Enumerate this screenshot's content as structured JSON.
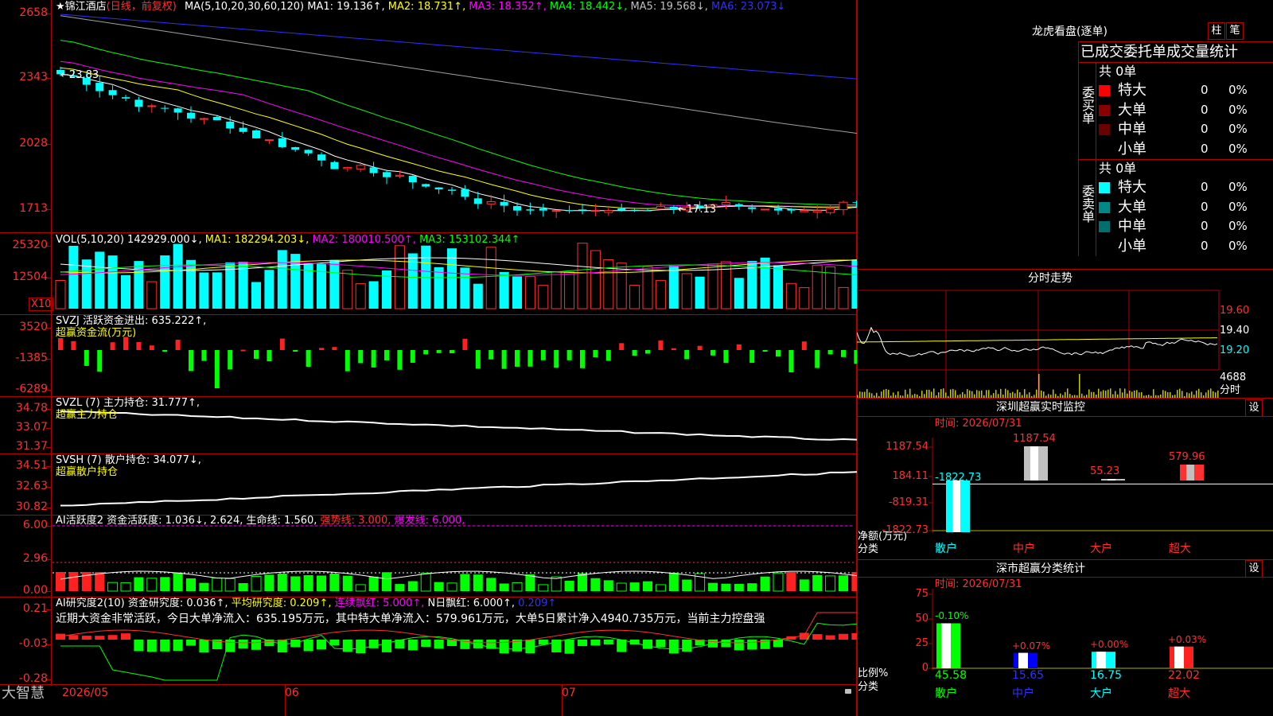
{
  "header": {
    "stock_name": "★锦江酒店",
    "period": "(日线，前复权)",
    "ma_label": "MA(5,10,20,30,60,120)",
    "ma": [
      {
        "label": "MA1: 19.136↑",
        "color": "#ffffff"
      },
      {
        "label": "MA2: 18.731↑",
        "color": "#ffff00"
      },
      {
        "label": "MA3: 18.352↑",
        "color": "#ff00ff"
      },
      {
        "label": "MA4: 18.442↓",
        "color": "#00ff00"
      },
      {
        "label": "MA5: 19.568↓",
        "color": "#c0c0c0"
      },
      {
        "label": "MA6: 23.073↓",
        "color": "#3030ff"
      }
    ]
  },
  "price_panel": {
    "y_ticks": [
      "2658",
      "2343",
      "2028",
      "1713"
    ],
    "high_marker": "←23.83",
    "low_marker": "←17.13"
  },
  "vol_panel": {
    "title": "VOL(5,10,20)",
    "value": "142929.000↓,",
    "ma1": "MA1: 182294.203↓,",
    "ma2": "MA2: 180010.500↑,",
    "ma3": "MA3: 153102.344↑",
    "y_ticks": [
      "25320",
      "12504"
    ],
    "unit": "X10"
  },
  "svzj_panel": {
    "title": "SVZJ  活跃资金进出: 635.222↑,",
    "subtitle": "超赢资金流(万元)",
    "y_ticks": [
      "3520",
      "-1385",
      "-6289"
    ]
  },
  "svzl_panel": {
    "title": "SVZL (7) 主力持仓: 31.777↑,",
    "subtitle": "超赢主力持仓",
    "y_ticks": [
      "34.78",
      "33.07",
      "31.37"
    ]
  },
  "svsh_panel": {
    "title": "SVSH (7) 散户持仓: 34.077↓,",
    "subtitle": "超赢散户持仓",
    "y_ticks": [
      "34.51",
      "32.63",
      "30.82"
    ]
  },
  "ai_active_panel": {
    "title": "AI活跃度2 资金活跃度: 1.036↓,",
    "v2": "2.624,",
    "life": "生命线: 1.560,",
    "strong": "强势线: 3.000,",
    "burst": "爆发线: 6.000,",
    "y_ticks": [
      "6.00",
      "2.96",
      "0.00"
    ]
  },
  "ai_research_panel": {
    "title": "AI研究度2(10) 资金研究度: 0.036↑,",
    "avg": "平均研究度: 0.209↑,",
    "cont": "连续飘红: 5.000↑,",
    "nday": "N日飘红: 6.000↑,",
    "last": "0.209↑",
    "comment": "近期大资金非常活跃，今日大单净流入：635.195万元，其中特大单净流入：579.961万元，大单5日累计净入4940.735万元，当前主力控盘强",
    "y_ticks": [
      "0.21",
      "-0.03",
      "-0.28"
    ]
  },
  "bottom_bar": {
    "brand": "大智慧",
    "dates": [
      "2026/05",
      "06",
      "07"
    ]
  },
  "lhb": {
    "title": "龙虎看盘(逐单)",
    "btn_zhu": "柱",
    "btn_bi": "笔",
    "tab_deal": "已成交",
    "tab_order": "委托单成交量统计",
    "buy_label": "委买单",
    "sell_label": "委卖单",
    "buy_total": "共 0单",
    "sell_total": "共 0单",
    "buy_rows": [
      {
        "label": "特大",
        "count": "0",
        "pct": "0%",
        "color": "#ff0000"
      },
      {
        "label": "大单",
        "count": "0",
        "pct": "0%",
        "color": "#8a0000"
      },
      {
        "label": "中单",
        "count": "0",
        "pct": "0%",
        "color": "#6a0000"
      },
      {
        "label": "小单",
        "count": "0",
        "pct": "0%",
        "color": "#000000"
      }
    ],
    "sell_rows": [
      {
        "label": "特大",
        "count": "0",
        "pct": "0%",
        "color": "#00ffff"
      },
      {
        "label": "大单",
        "count": "0",
        "pct": "0%",
        "color": "#008888"
      },
      {
        "label": "中单",
        "count": "0",
        "pct": "0%",
        "color": "#006f6f"
      },
      {
        "label": "小单",
        "count": "0",
        "pct": "0%",
        "color": "#000000"
      }
    ]
  },
  "fenshi": {
    "title": "分时走势",
    "y_ticks": [
      "19.60",
      "19.40",
      "19.20"
    ],
    "vol_tick": "4688",
    "vol_label": "分时"
  },
  "sz_monitor": {
    "title": "深圳超赢实时监控",
    "btn": "设",
    "time": "时间: 2026/07/31",
    "y_ticks": [
      "1187.54",
      "184.11",
      "-819.31",
      "-1822.73"
    ],
    "ylabel1": "净额(万元)",
    "ylabel2": "分类",
    "categories": [
      "散户",
      "中户",
      "大户",
      "超大"
    ],
    "values": [
      -1822.73,
      1187.54,
      55.23,
      579.96
    ],
    "value_labels": [
      "-1822.73",
      "1187.54",
      "55.23",
      "579.96"
    ]
  },
  "sz_stats": {
    "title": "深市超赢分类统计",
    "btn": "设",
    "time": "时间: 2026/07/31",
    "y_ticks": [
      "75",
      "50",
      "25",
      "0"
    ],
    "ylabel1": "比例%",
    "ylabel2": "分类",
    "categories": [
      "散户",
      "中户",
      "大户",
      "超大"
    ],
    "values": [
      45.58,
      15.65,
      16.75,
      22.02
    ],
    "value_labels": [
      "45.58",
      "15.65",
      "16.75",
      "22.02"
    ],
    "changes": [
      "-0.10%",
      "+0.07%",
      "+0.00%",
      "+0.03%"
    ]
  }
}
